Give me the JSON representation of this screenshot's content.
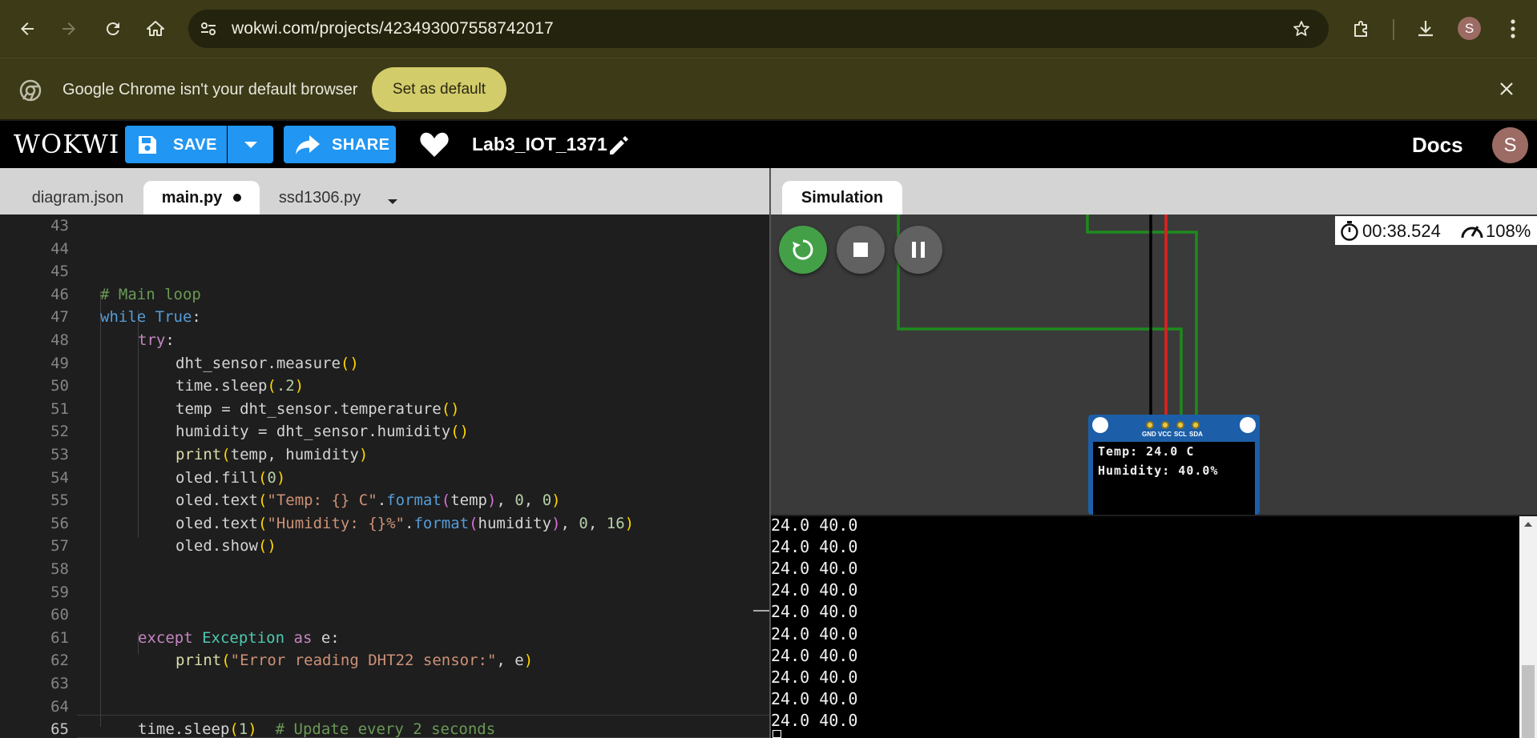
{
  "browser": {
    "url": "wokwi.com/projects/423493007558742017",
    "profile_initial": "S"
  },
  "infobar": {
    "message": "Google Chrome isn't your default browser",
    "button": "Set as default"
  },
  "header": {
    "logo": "WOKWI",
    "save_label": "SAVE",
    "share_label": "SHARE",
    "project_name": "Lab3_IOT_1371",
    "docs_label": "Docs",
    "user_initial": "S"
  },
  "editor_tabs": [
    {
      "label": "diagram.json",
      "active": false
    },
    {
      "label": "main.py",
      "active": true,
      "modified": true
    },
    {
      "label": "ssd1306.py",
      "active": false
    }
  ],
  "simulation": {
    "tab_label": "Simulation",
    "timer": "00:38.524",
    "speed": "108%",
    "oled_line1": "Temp: 24.0 C",
    "oled_line2": "Humidity: 40.0%",
    "pins": [
      "GND",
      "VCC",
      "SCL",
      "SDA"
    ]
  },
  "code": {
    "current_line": 65,
    "lines": [
      {
        "n": 43,
        "indent": 0,
        "tokens": []
      },
      {
        "n": 44,
        "indent": 0,
        "tokens": []
      },
      {
        "n": 45,
        "indent": 0,
        "tokens": []
      },
      {
        "n": 46,
        "indent": 0,
        "tokens": [
          [
            "cm",
            "# Main loop"
          ]
        ]
      },
      {
        "n": 47,
        "indent": 0,
        "tokens": [
          [
            "kw",
            "while"
          ],
          [
            "",
            " "
          ],
          [
            "kw",
            "True"
          ],
          [
            "",
            ":"
          ]
        ]
      },
      {
        "n": 48,
        "indent": 1,
        "tokens": [
          [
            "kw2",
            "try"
          ],
          [
            "",
            ":"
          ]
        ]
      },
      {
        "n": 49,
        "indent": 2,
        "tokens": [
          [
            "",
            "dht_sensor.measure"
          ],
          [
            "p1",
            "()"
          ]
        ]
      },
      {
        "n": 50,
        "indent": 2,
        "tokens": [
          [
            "",
            "time.sleep"
          ],
          [
            "p1",
            "("
          ],
          [
            "num",
            ".2"
          ],
          [
            "p1",
            ")"
          ]
        ]
      },
      {
        "n": 51,
        "indent": 2,
        "tokens": [
          [
            "",
            "temp = dht_sensor.temperature"
          ],
          [
            "p1",
            "()"
          ]
        ]
      },
      {
        "n": 52,
        "indent": 2,
        "tokens": [
          [
            "",
            "humidity = dht_sensor.humidity"
          ],
          [
            "p1",
            "()"
          ]
        ]
      },
      {
        "n": 53,
        "indent": 2,
        "tokens": [
          [
            "fn",
            "print"
          ],
          [
            "p1",
            "("
          ],
          [
            "",
            "temp, humidity"
          ],
          [
            "p1",
            ")"
          ]
        ]
      },
      {
        "n": 54,
        "indent": 2,
        "tokens": [
          [
            "",
            "oled.fill"
          ],
          [
            "p1",
            "("
          ],
          [
            "num",
            "0"
          ],
          [
            "p1",
            ")"
          ]
        ]
      },
      {
        "n": 55,
        "indent": 2,
        "tokens": [
          [
            "",
            "oled.text"
          ],
          [
            "p1",
            "("
          ],
          [
            "str",
            "\"Temp: {} C\""
          ],
          [
            "",
            "."
          ],
          [
            "kw",
            "format"
          ],
          [
            "p2",
            "("
          ],
          [
            "",
            "temp"
          ],
          [
            "p2",
            ")"
          ],
          [
            "",
            ", "
          ],
          [
            "num",
            "0"
          ],
          [
            "",
            ", "
          ],
          [
            "num",
            "0"
          ],
          [
            "p1",
            ")"
          ]
        ]
      },
      {
        "n": 56,
        "indent": 2,
        "tokens": [
          [
            "",
            "oled.text"
          ],
          [
            "p1",
            "("
          ],
          [
            "str",
            "\"Humidity: {}%\""
          ],
          [
            "",
            "."
          ],
          [
            "kw",
            "format"
          ],
          [
            "p2",
            "("
          ],
          [
            "",
            "humidity"
          ],
          [
            "p2",
            ")"
          ],
          [
            "",
            ", "
          ],
          [
            "num",
            "0"
          ],
          [
            "",
            ", "
          ],
          [
            "num",
            "16"
          ],
          [
            "p1",
            ")"
          ]
        ]
      },
      {
        "n": 57,
        "indent": 2,
        "tokens": [
          [
            "",
            "oled.show"
          ],
          [
            "p1",
            "()"
          ]
        ]
      },
      {
        "n": 58,
        "indent": 0,
        "tokens": []
      },
      {
        "n": 59,
        "indent": 0,
        "tokens": []
      },
      {
        "n": 60,
        "indent": 0,
        "tokens": []
      },
      {
        "n": 61,
        "indent": 1,
        "tokens": [
          [
            "kw2",
            "except"
          ],
          [
            "",
            " "
          ],
          [
            "cls",
            "Exception"
          ],
          [
            "",
            " "
          ],
          [
            "kw2",
            "as"
          ],
          [
            "",
            " e:"
          ]
        ]
      },
      {
        "n": 62,
        "indent": 2,
        "tokens": [
          [
            "fn",
            "print"
          ],
          [
            "p1",
            "("
          ],
          [
            "str",
            "\"Error reading DHT22 sensor:\""
          ],
          [
            "",
            ", e"
          ],
          [
            "p1",
            ")"
          ]
        ]
      },
      {
        "n": 63,
        "indent": 0,
        "tokens": []
      },
      {
        "n": 64,
        "indent": 0,
        "tokens": []
      },
      {
        "n": 65,
        "indent": 1,
        "tokens": [
          [
            "",
            "time.sleep"
          ],
          [
            "p1",
            "("
          ],
          [
            "num",
            "1"
          ],
          [
            "p1",
            ")"
          ],
          [
            "",
            "  "
          ],
          [
            "cm",
            "# Update every 2 seconds"
          ]
        ]
      }
    ]
  },
  "serial_output": [
    "24.0 40.0",
    "24.0 40.0",
    "24.0 40.0",
    "24.0 40.0",
    "24.0 40.0",
    "24.0 40.0",
    "24.0 40.0",
    "24.0 40.0",
    "24.0 40.0",
    "24.0 40.0"
  ],
  "colors": {
    "wokwi_blue": "#2196f3",
    "sim_green": "#43a047",
    "wire_green": "#1e8a1e",
    "wire_red": "#e02020",
    "oled_blue": "#1c5fa8"
  }
}
